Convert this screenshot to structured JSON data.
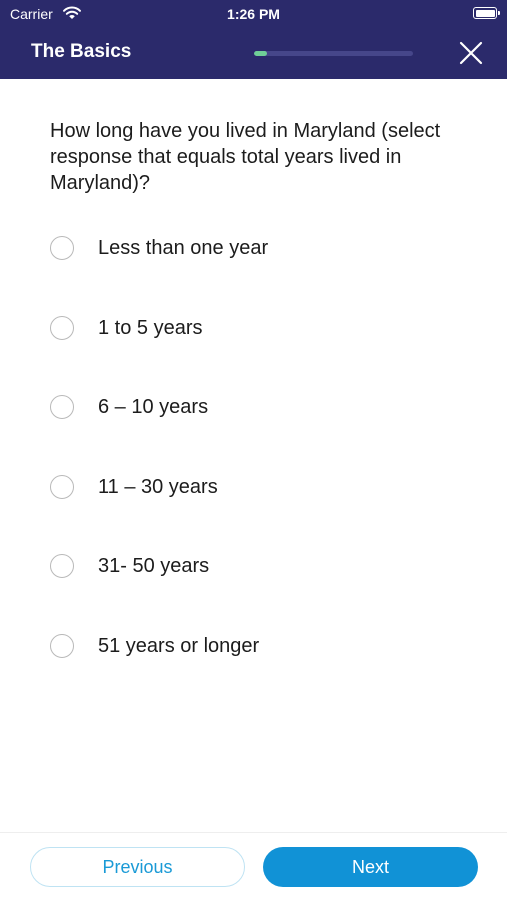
{
  "status_bar": {
    "carrier": "Carrier",
    "time": "1:26 PM",
    "wifi_icon": "wifi-icon",
    "battery_icon": "battery-icon"
  },
  "header": {
    "title": "The Basics",
    "progress_fraction": 0.08,
    "close_icon": "close-icon",
    "background_color": "#2b2a6b",
    "progress_color": "#6fcf97"
  },
  "question": {
    "text": "How long have you lived in Maryland (select response that equals total years lived in Maryland)?"
  },
  "options": [
    {
      "label": "Less than one year"
    },
    {
      "label": "1 to 5 years"
    },
    {
      "label": "6 – 10 years"
    },
    {
      "label": "11 – 30 years"
    },
    {
      "label": "31- 50 years"
    },
    {
      "label": "51 years or longer"
    }
  ],
  "footer": {
    "previous_label": "Previous",
    "next_label": "Next",
    "accent_color": "#1192d6"
  }
}
